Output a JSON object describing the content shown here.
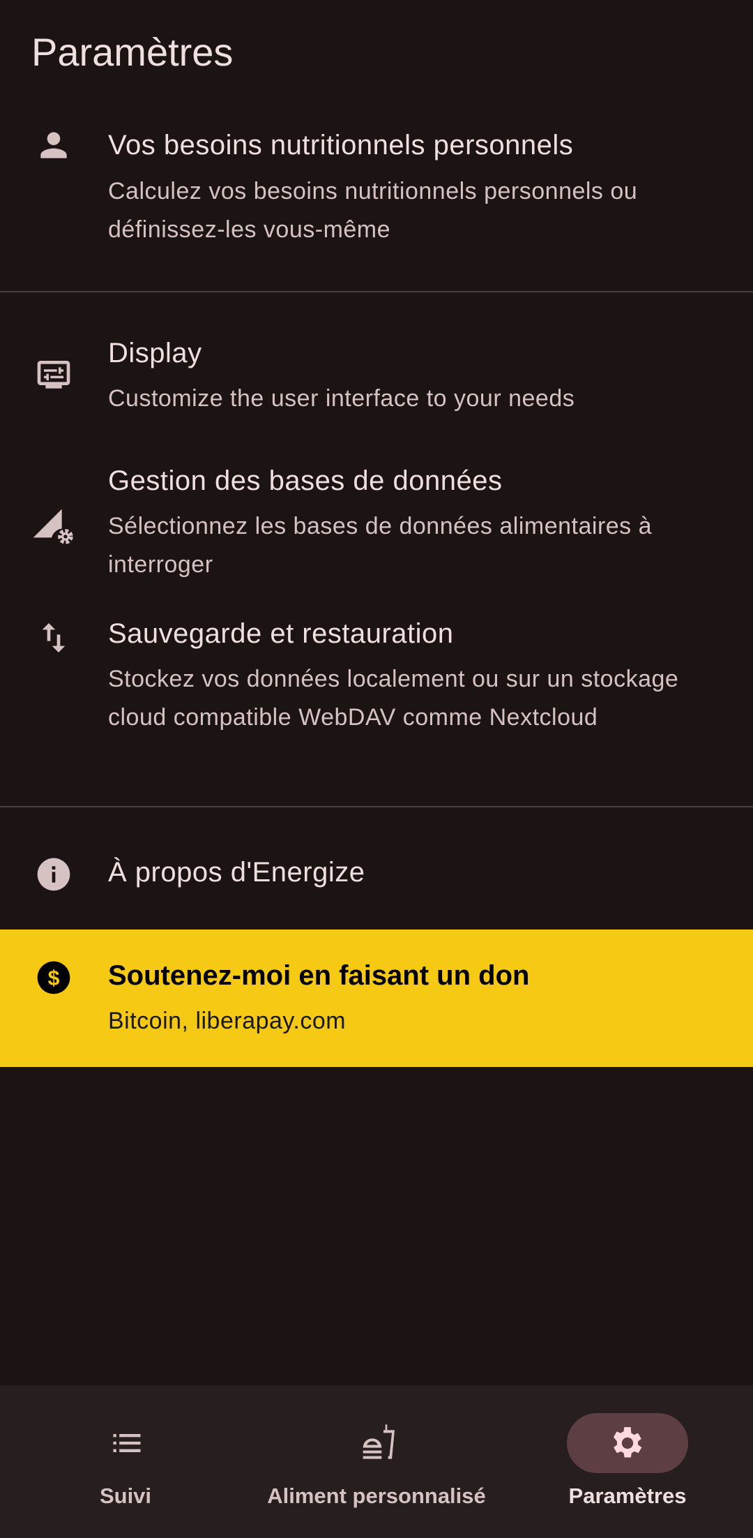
{
  "header": {
    "title": "Paramètres"
  },
  "items": [
    {
      "title": "Vos besoins nutritionnels personnels",
      "subtitle": "Calculez vos besoins nutritionnels personnels ou définissez-les vous-même",
      "icon": "person-icon"
    },
    {
      "title": "Display",
      "subtitle": "Customize the user interface to your needs",
      "icon": "display-settings-icon"
    },
    {
      "title": "Gestion des bases de données",
      "subtitle": "Sélectionnez les bases de données alimentaires à interroger",
      "icon": "database-settings-icon"
    },
    {
      "title": "Sauvegarde et restauration",
      "subtitle": "Stockez vos données localement ou sur un stockage cloud compatible WebDAV comme Nextcloud",
      "icon": "import-export-icon"
    },
    {
      "title": "À propos d'Energize",
      "icon": "info-icon"
    }
  ],
  "donate": {
    "title": "Soutenez-moi en faisant un don",
    "subtitle": "Bitcoin, liberapay.com",
    "icon": "dollar-icon",
    "color": "#f6c915"
  },
  "nav": {
    "items": [
      {
        "label": "Suivi",
        "icon": "list-icon"
      },
      {
        "label": "Aliment personnalisé",
        "icon": "food-icon"
      },
      {
        "label": "Paramètres",
        "icon": "gear-icon",
        "selected": true
      }
    ]
  }
}
